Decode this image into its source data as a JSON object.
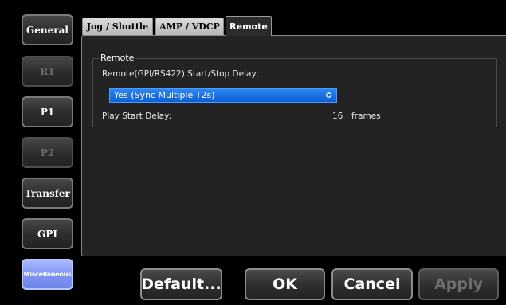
{
  "sidebar": {
    "items": [
      {
        "label": "General",
        "state": "normal"
      },
      {
        "label": "R1",
        "state": "disabled"
      },
      {
        "label": "P1",
        "state": "normal"
      },
      {
        "label": "P2",
        "state": "disabled"
      },
      {
        "label": "Transfer",
        "state": "normal"
      },
      {
        "label": "GPI",
        "state": "normal"
      },
      {
        "label": "Miscellaneous",
        "state": "selected"
      }
    ]
  },
  "tabs": [
    {
      "label": "Jog / Shuttle",
      "active": false
    },
    {
      "label": "AMP / VDCP",
      "active": false
    },
    {
      "label": "Remote",
      "active": true
    }
  ],
  "remote_group": {
    "title": "Remote",
    "start_stop_delay_label": "Remote(GPI/RS422) Start/Stop Delay:",
    "start_stop_delay_value": "Yes (Sync Multiple T2s)",
    "play_start_delay_label": "Play Start Delay:",
    "play_start_delay_value": "16",
    "play_start_delay_unit": "frames"
  },
  "actions": {
    "default_label": "Default...",
    "ok_label": "OK",
    "cancel_label": "Cancel",
    "apply_label": "Apply",
    "apply_enabled": false
  },
  "colors": {
    "selected_sidebar": "#8096f0",
    "dropdown_highlight": "#1a6fe6",
    "panel_background": "#232323"
  },
  "icons": {
    "dropdown": "chevron-down-icon"
  }
}
